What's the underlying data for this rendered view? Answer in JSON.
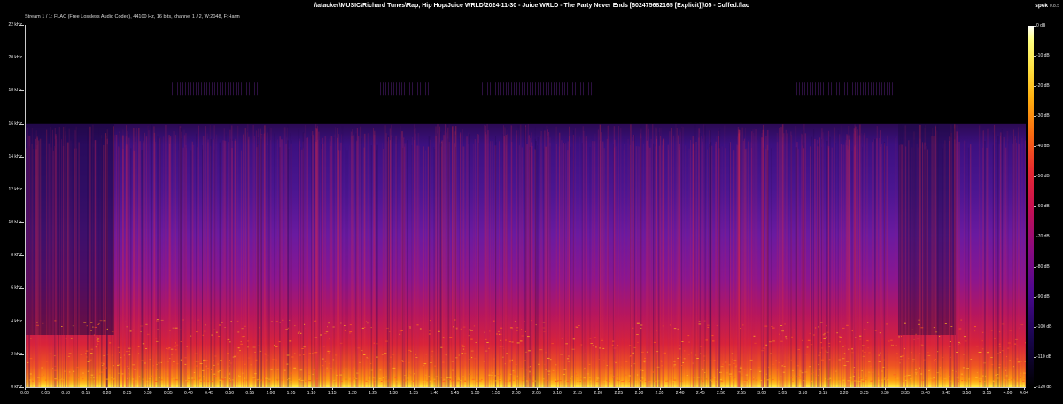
{
  "window": {
    "title": "\\\\atacker\\MUSIC\\Richard Tunes\\Rap, Hip Hop\\Juice WRLD\\2024-11-30 - Juice WRLD - The Party Never Ends [602475682165 [Explicit]]\\05 - Cuffed.flac",
    "stream_info": "Stream 1 / 1: FLAC (Free Lossless Audio Codec), 44100 Hz, 16 bits, channel 1 / 2, W:2048, F:Hann",
    "app_name": "spek",
    "app_version": "0.8.5"
  },
  "spectrogram": {
    "freq_axis_labels": [
      "22 kHz",
      "20 kHz",
      "18 kHz",
      "16 kHz",
      "14 kHz",
      "12 kHz",
      "10 kHz",
      "8 kHz",
      "6 kHz",
      "4 kHz",
      "2 kHz",
      "0 kHz"
    ],
    "freq_axis_range_khz": [
      0,
      22
    ],
    "time_axis_labels": [
      "0:00",
      "0:05",
      "0:10",
      "0:15",
      "0:20",
      "0:25",
      "0:30",
      "0:35",
      "0:40",
      "0:45",
      "0:50",
      "0:55",
      "1:00",
      "1:05",
      "1:10",
      "1:15",
      "1:20",
      "1:25",
      "1:30",
      "1:35",
      "1:40",
      "1:45",
      "1:50",
      "1:55",
      "2:00",
      "2:05",
      "2:10",
      "2:15",
      "2:20",
      "2:25",
      "2:30",
      "2:35",
      "2:40",
      "2:45",
      "2:50",
      "2:55",
      "3:00",
      "3:05",
      "3:10",
      "3:15",
      "3:20",
      "3:25",
      "3:30",
      "3:35",
      "3:40",
      "3:45",
      "3:50",
      "3:55",
      "4:00",
      "4:04"
    ],
    "time_axis_range_s": [
      0,
      244
    ],
    "lowpass_cutoff_khz": 16
  },
  "colorbar": {
    "labels": [
      "0 dB",
      "-10 dB",
      "-20 dB",
      "-30 dB",
      "-40 dB",
      "-50 dB",
      "-60 dB",
      "-70 dB",
      "-80 dB",
      "-90 dB",
      "-100 dB",
      "-110 dB",
      "-120 dB"
    ],
    "range_db": [
      -120,
      0
    ]
  }
}
